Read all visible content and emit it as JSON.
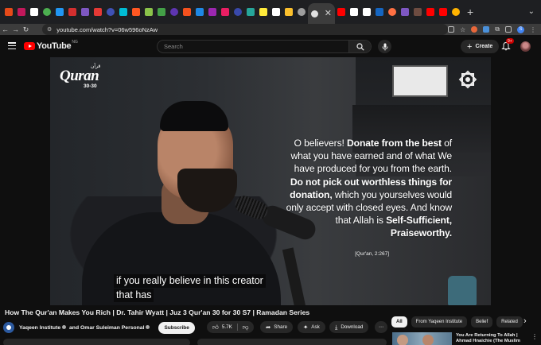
{
  "browser": {
    "url": "youtube.com/watch?v=06w596oNzAw",
    "tab_colors": [
      "#e64a19",
      "#c2185b",
      "#ffffff",
      "#4caf50",
      "#2196f3",
      "#d32f2f",
      "#7e57c2",
      "#e53935",
      "#3f51b5",
      "#00bcd4",
      "#ff5722",
      "#8bc34a",
      "#43a047",
      "#5e35b1",
      "#f4511e",
      "#1e88e5",
      "#9c27b0",
      "#e91e63",
      "#3949ab",
      "#26a69a",
      "#ffeb3b",
      "#ffffff",
      "#fbc02d",
      "#9e9e9e",
      "#ff0000",
      "#ffffff",
      "#ffffff",
      "#1565c0",
      "#ff7043",
      "#7e57c2",
      "#6d4c41",
      "#ff0000",
      "#ff0000",
      "#ffb300"
    ],
    "active_tab_icon_color": "#e0e0e0",
    "profile_letter": "S"
  },
  "masthead": {
    "logo_text": "YouTube",
    "country_code": "NG",
    "search_placeholder": "Search",
    "create_label": "Create",
    "notification_count": "9+"
  },
  "player": {
    "logo_main": "Quran",
    "logo_sub": "30-30",
    "logo_arabic": "قرآن",
    "verse_parts": [
      {
        "t": "O believers! ",
        "b": false
      },
      {
        "t": "Donate from the best",
        "b": true
      },
      {
        "t": " of what you have earned and of what We have produced for you from the earth. ",
        "b": false
      },
      {
        "t": "Do not pick out worthless things for donation,",
        "b": true
      },
      {
        "t": " which you yourselves would only accept with closed eyes. And know that Allah is ",
        "b": false
      },
      {
        "t": "Self-Sufficient, Praiseworthy.",
        "b": true
      }
    ],
    "verse_reference": "[Qur'an, 2:267]",
    "caption_line1": "if you really believe in this creator",
    "caption_line2": "that has"
  },
  "video": {
    "title": "How The Qur'an Makes You Rich | Dr. Tahir Wyatt | Juz 3 Qur'an 30 for 30 S7 | Ramadan Series",
    "channel_name_1": "Yaqeen Institute",
    "channel_connector": "and",
    "channel_name_2": "Omar Suleiman Personal",
    "subscribe_label": "Subscribe",
    "like_count": "5.7K",
    "share_label": "Share",
    "ask_label": "Ask",
    "download_label": "Download"
  },
  "sidebar": {
    "chips": [
      "All",
      "From Yaqeen Institute",
      "Belief",
      "Related"
    ],
    "related_title": "You Are Returning To Allah | Ahmad Hnaichie (The Muslim"
  }
}
